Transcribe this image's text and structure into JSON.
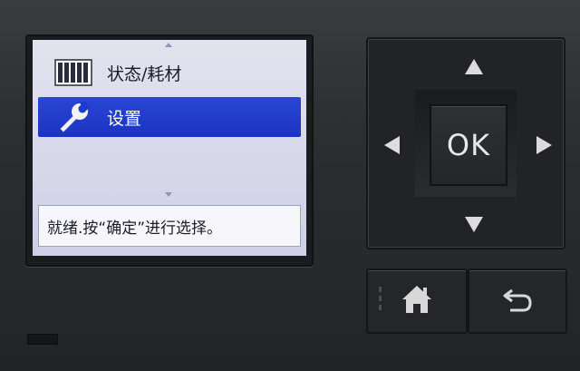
{
  "lcd": {
    "menu_items": [
      {
        "label": "状态/耗材",
        "icon": "ink-cartridges-icon",
        "selected": false
      },
      {
        "label": "设置",
        "icon": "wrench-icon",
        "selected": true
      }
    ],
    "status_message": "就绪.按“确定”进行选择。"
  },
  "panel": {
    "ok_label": "OK",
    "buttons": [
      "up-arrow",
      "down-arrow",
      "left-arrow",
      "right-arrow",
      "ok",
      "home",
      "back"
    ]
  },
  "colors": {
    "lcd_background": "#d7d8ea",
    "selection": "#1f3bcc",
    "panel": "#2c2e31",
    "glyph": "#dcdcdc"
  }
}
